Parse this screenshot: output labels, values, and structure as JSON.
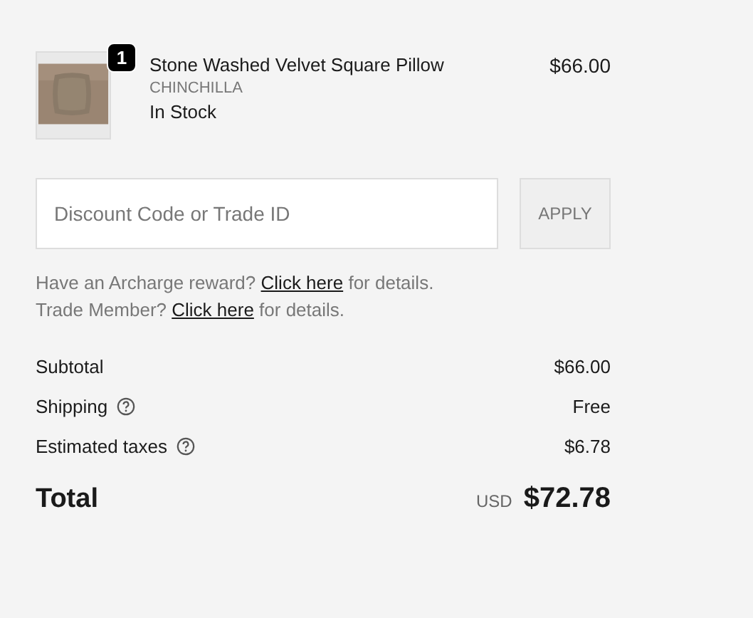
{
  "item": {
    "quantity": "1",
    "name": "Stone Washed Velvet Square Pillow",
    "variant": "CHINCHILLA",
    "availability": "In Stock",
    "price": "$66.00"
  },
  "discount": {
    "placeholder": "Discount Code or Trade ID",
    "button": "APPLY"
  },
  "notes": [
    {
      "before": "Have an Archarge reward?",
      "link": "Click here",
      "after": "for details."
    },
    {
      "before": "Trade Member?",
      "link": "Click here",
      "after": "for details."
    }
  ],
  "summary": [
    {
      "label": "Subtotal",
      "info": false,
      "value": "$66.00"
    },
    {
      "label": "Shipping",
      "info": true,
      "value": "Free"
    },
    {
      "label": "Estimated taxes",
      "info": true,
      "value": "$6.78"
    }
  ],
  "total": {
    "label": "Total",
    "currency": "USD",
    "value": "$72.78"
  }
}
